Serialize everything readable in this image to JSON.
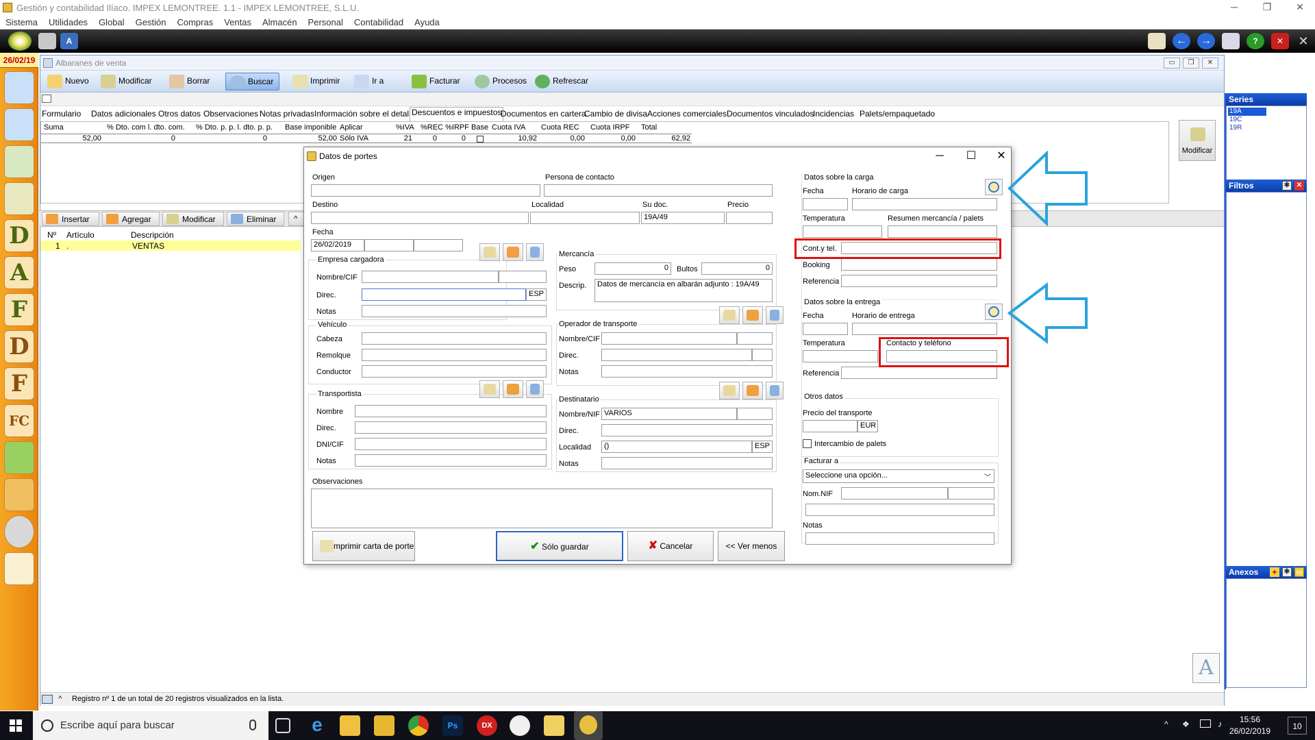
{
  "app": {
    "title": "Gestión y contabilidad Ilíaco. IMPEX LEMONTREE. 1.1 - IMPEX LEMONTREE, S.L.U.",
    "menu": [
      "Sistema",
      "Utilidades",
      "Global",
      "Gestión",
      "Compras",
      "Ventas",
      "Almacén",
      "Personal",
      "Contabilidad",
      "Ayuda"
    ],
    "date_badge": "26/02/19"
  },
  "dock": {
    "letters": [
      "D",
      "A",
      "F",
      "D",
      "F",
      "FC"
    ]
  },
  "main": {
    "title": "Albaranes de venta",
    "ribbon": [
      "Nuevo",
      "Modificar",
      "Borrar",
      "Buscar",
      "Imprimir",
      "Ir a",
      "Facturar",
      "Procesos",
      "Refrescar"
    ],
    "tabs": [
      "Formulario",
      "Datos adicionales",
      "Otros datos",
      "Observaciones",
      "Notas privadas",
      "Información sobre el detalle",
      "Descuentos e impuestos",
      "Documentos en cartera",
      "Cambio de divisa",
      "Acciones comerciales",
      "Documentos vinculados",
      "Incidencias",
      "Palets/empaquetado"
    ],
    "summary": {
      "headers": [
        "Suma",
        "% Dto. com l. dto. com.",
        "% Dto. p. p. l. dto. p. p.",
        "Base imponible",
        "Aplicar",
        "%IVA",
        "%REC",
        "%IRPF",
        "Base",
        "Cuota IVA",
        "Cuota REC",
        "Cuota IRPF",
        "Total"
      ],
      "values": [
        "52,00",
        "0",
        "0",
        "52,00",
        "Sólo IVA",
        "21",
        "0",
        "0",
        "",
        "10,92",
        "0,00",
        "0,00",
        "62,92"
      ]
    },
    "modify_label": "Modificar",
    "linebar": [
      "Insertar",
      "Agregar",
      "Modificar",
      "Eliminar"
    ],
    "lines": {
      "headers": [
        "Nº",
        "Artículo",
        "Descripción"
      ],
      "rows": [
        {
          "n": "1",
          "art": ".",
          "desc": "VENTAS"
        }
      ]
    },
    "status": "Registro nº 1 de un total de 20 registros visualizados en la lista."
  },
  "right": {
    "series_title": "Series",
    "series": [
      "19A",
      "19C",
      "19R"
    ],
    "filtros_title": "Filtros",
    "anexos_title": "Anexos"
  },
  "dialog": {
    "title": "Datos de portes",
    "origen": "Origen",
    "persona_contacto": "Persona de contacto",
    "destino": "Destino",
    "localidad": "Localidad",
    "su_doc": "Su doc.",
    "su_doc_val": "19A/49",
    "precio": "Precio",
    "fecha": "Fecha",
    "fecha_val": "26/02/2019",
    "empresa": {
      "title": "Empresa cargadora",
      "nombre": "Nombre/CIF",
      "direc": "Direc.",
      "direc_code": "ESP",
      "notas": "Notas"
    },
    "vehiculo": {
      "title": "Vehículo",
      "cabeza": "Cabeza",
      "remolque": "Remolque",
      "conductor": "Conductor"
    },
    "transportista": {
      "title": "Transportista",
      "nombre": "Nombre",
      "direc": "Direc.",
      "dni": "DNI/CIF",
      "notas": "Notas"
    },
    "mercancia": {
      "title": "Mercancía",
      "peso": "Peso",
      "peso_val": "0",
      "bultos": "Bultos",
      "bultos_val": "0",
      "descrip": "Descrip.",
      "descrip_val": "Datos de mercancía en albarán adjunto : 19A/49"
    },
    "operador": {
      "title": "Operador de transporte",
      "nombre": "Nombre/CIF",
      "direc": "Direc.",
      "notas": "Notas"
    },
    "destinatario": {
      "title": "Destinatario",
      "nombre": "Nombre/NIF",
      "nombre_val": "VARIOS",
      "direc": "Direc.",
      "localidad": "Localidad",
      "localidad_val": "()",
      "localidad_code": "ESP",
      "notas": "Notas"
    },
    "observaciones": "Observaciones",
    "carga": {
      "title": "Datos sobre la carga",
      "fecha": "Fecha",
      "horario": "Horario de carga",
      "temperatura": "Temperatura",
      "resumen": "Resumen mercancía / palets",
      "cont": "Cont.y tel.",
      "booking": "Booking",
      "referencia": "Referencia"
    },
    "entrega": {
      "title": "Datos sobre la entrega",
      "fecha": "Fecha",
      "horario": "Horario de entrega",
      "temperatura": "Temperatura",
      "contacto": "Contacto y teléfono",
      "referencia": "Referencia"
    },
    "otros": {
      "title": "Otros datos",
      "precio": "Precio del transporte",
      "currency": "EUR",
      "intercambio": "Intercambio de palets"
    },
    "facturar": {
      "title": "Facturar a",
      "select": "Seleccione una opción...",
      "nomnif": "Nom.NIF",
      "notas": "Notas"
    },
    "buttons": {
      "imprimir": "Imprimir carta de porte",
      "guardar": "Sólo guardar",
      "cancelar": "Cancelar",
      "menos": "<< Ver menos"
    }
  },
  "taskbar": {
    "search": "Escribe aquí para buscar",
    "time": "15:56",
    "date": "26/02/2019",
    "notif": "10"
  },
  "colors": {
    "accent_blue": "#2aa3dc",
    "highlight_red": "#e01010"
  }
}
